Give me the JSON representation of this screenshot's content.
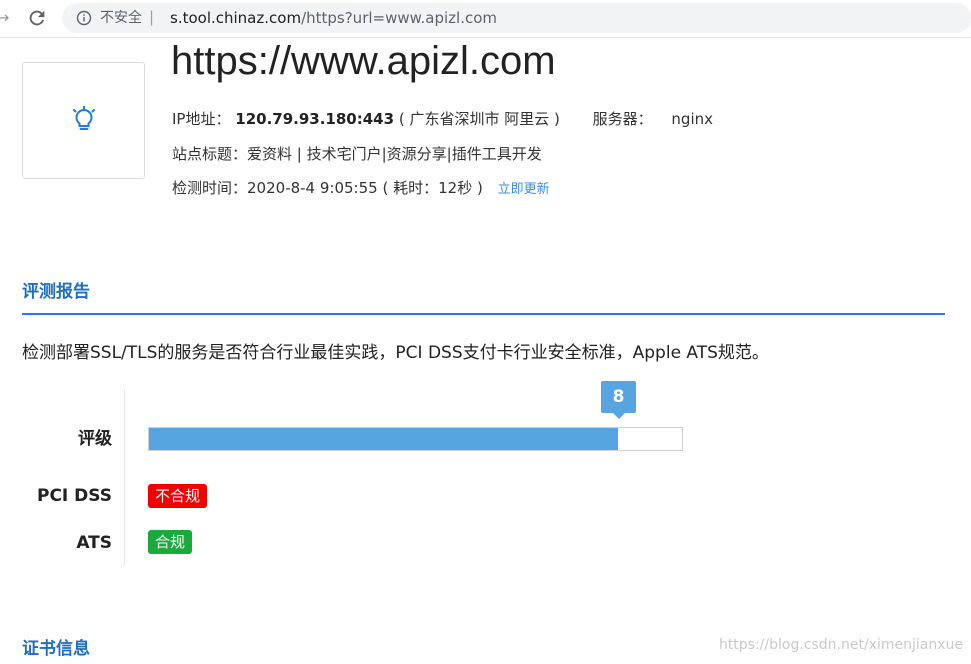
{
  "browser": {
    "security_label": "不安全",
    "separator": "|",
    "url_host": "s.tool.chinaz.com",
    "url_path": "/https?url=www.apizl.com"
  },
  "site": {
    "title": "https://www.apizl.com",
    "ip_label": "IP地址：",
    "ip_value": "120.79.93.180:443",
    "ip_location": "( 广东省深圳市 阿里云 )",
    "server_label": "服务器：",
    "server_value": "nginx",
    "site_title_label": "站点标题：",
    "site_title_value": "爱资料 | 技术宅门户|资源分享|插件工具开发",
    "check_time_label": "检测时间：",
    "check_time_value": "2020-8-4 9:05:55",
    "elapsed": "( 耗时：12秒 )",
    "refresh_link": "立即更新"
  },
  "report": {
    "section_title": "评测报告",
    "description": "检测部署SSL/TLS的服务是否符合行业最佳实践，PCI DSS支付卡行业安全标准，Apple ATS规范。",
    "grade_label": "评级",
    "grade_score": "8",
    "grade_fraction": 0.88,
    "pci_label": "PCI DSS",
    "pci_status": "不合规",
    "ats_label": "ATS",
    "ats_status": "合规"
  },
  "cert": {
    "section_title": "证书信息"
  },
  "colors": {
    "accent": "#1f6fbf",
    "bar": "#56a5e1",
    "fail": "#f00000",
    "pass": "#1aaa3b"
  },
  "watermark": "https://blog.csdn.net/ximenjianxue"
}
